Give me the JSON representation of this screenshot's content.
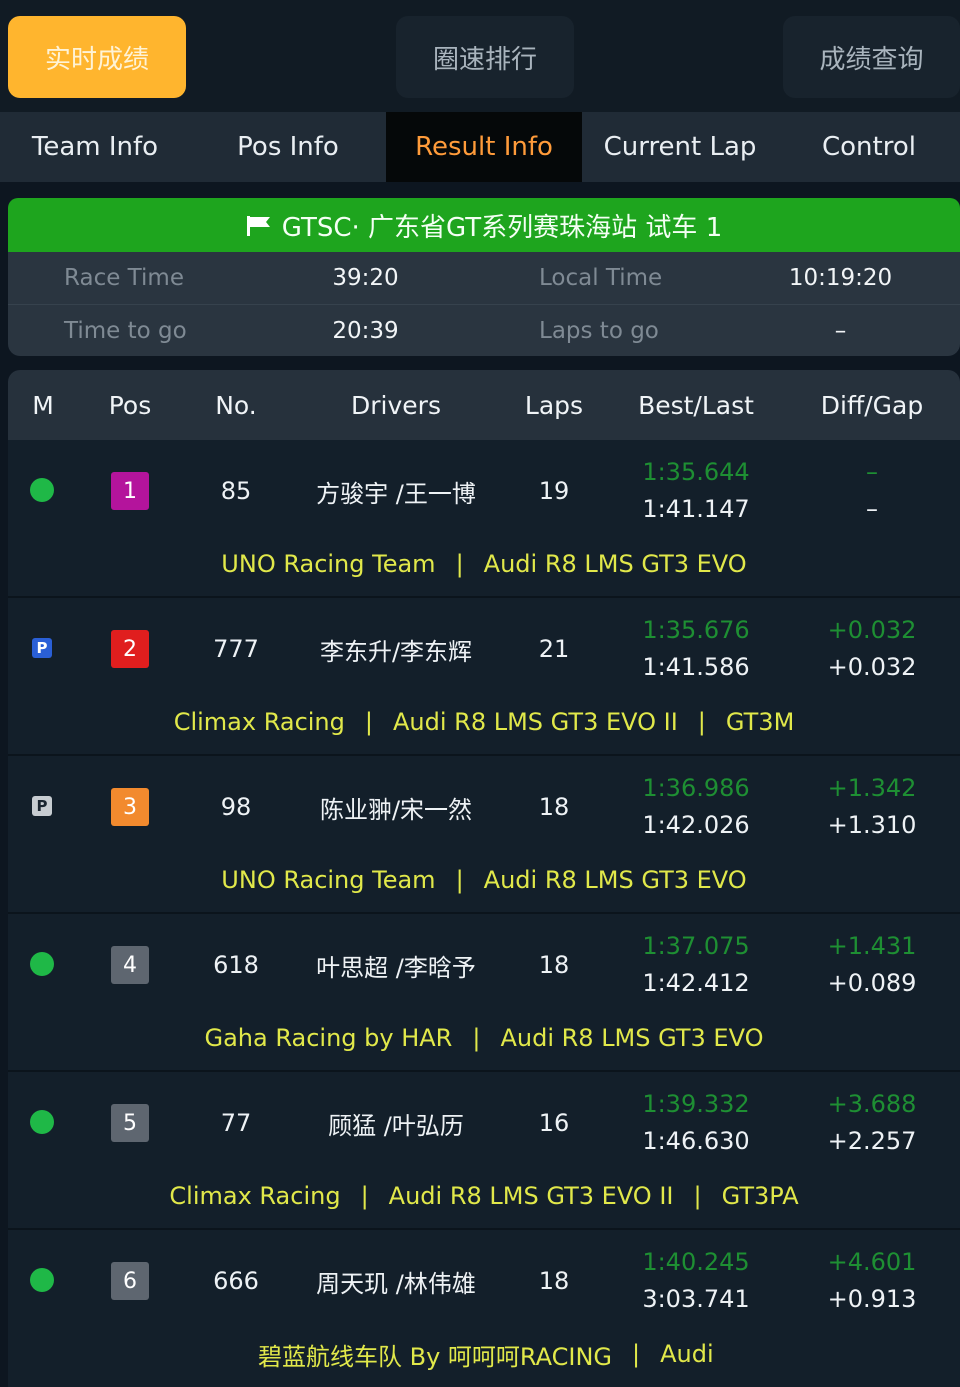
{
  "top_buttons": [
    {
      "label": "实时成绩",
      "active": true
    },
    {
      "label": "圈速排行",
      "active": false
    },
    {
      "label": "成绩查询",
      "active": false
    }
  ],
  "tabs": [
    {
      "label": "Team Info",
      "active": false
    },
    {
      "label": "Pos Info",
      "active": false
    },
    {
      "label": "Result Info",
      "active": true
    },
    {
      "label": "Current Lap",
      "active": false
    },
    {
      "label": "Control",
      "active": false
    }
  ],
  "race": {
    "title": "GTSC· 广东省GT系列赛珠海站 试车 1",
    "status_color": "#1ea51e",
    "race_time_label": "Race Time",
    "race_time": "39:20",
    "local_time_label": "Local Time",
    "local_time": "10:19:20",
    "time_to_go_label": "Time to go",
    "time_to_go": "20:39",
    "laps_to_go_label": "Laps to go",
    "laps_to_go": "–"
  },
  "table": {
    "headers": [
      "M",
      "Pos",
      "No.",
      "Drivers",
      "Laps",
      "Best/Last",
      "Diff/Gap"
    ],
    "rows": [
      {
        "marker": "green-dot",
        "pos": "1",
        "pos_color": "#b4149c",
        "no": "85",
        "drivers": "方骏宇 /王一博",
        "laps": "19",
        "best": "1:35.644",
        "last": "1:41.147",
        "diff": "–",
        "gap": "–",
        "team": "UNO Racing Team",
        "car": "Audi R8 LMS GT3 EVO",
        "class": ""
      },
      {
        "marker": "pit-blue",
        "pos": "2",
        "pos_color": "#e01e1e",
        "no": "777",
        "drivers": "李东升/李东辉",
        "laps": "21",
        "best": "1:35.676",
        "last": "1:41.586",
        "diff": "+0.032",
        "gap": "+0.032",
        "team": "Climax Racing",
        "car": "Audi R8 LMS GT3 EVO II",
        "class": "GT3M"
      },
      {
        "marker": "pit-grey",
        "pos": "3",
        "pos_color": "#f28a2e",
        "no": "98",
        "drivers": "陈业翀/宋一然",
        "laps": "18",
        "best": "1:36.986",
        "last": "1:42.026",
        "diff": "+1.342",
        "gap": "+1.310",
        "team": "UNO Racing Team",
        "car": "Audi R8 LMS GT3 EVO",
        "class": ""
      },
      {
        "marker": "green-dot",
        "pos": "4",
        "pos_color": "#5e6670",
        "no": "618",
        "drivers": "叶思超 /李晗予",
        "laps": "18",
        "best": "1:37.075",
        "last": "1:42.412",
        "diff": "+1.431",
        "gap": "+0.089",
        "team": "Gaha Racing by HAR",
        "car": "Audi R8 LMS GT3 EVO",
        "class": ""
      },
      {
        "marker": "green-dot",
        "pos": "5",
        "pos_color": "#5e6670",
        "no": "77",
        "drivers": "顾猛 /叶弘历",
        "laps": "16",
        "best": "1:39.332",
        "last": "1:46.630",
        "diff": "+3.688",
        "gap": "+2.257",
        "team": "Climax Racing",
        "car": "Audi R8 LMS GT3 EVO II",
        "class": "GT3PA"
      },
      {
        "marker": "green-dot",
        "pos": "6",
        "pos_color": "#5e6670",
        "no": "666",
        "drivers": "周天玑 /林伟雄",
        "laps": "18",
        "best": "1:40.245",
        "last": "3:03.741",
        "diff": "+4.601",
        "gap": "+0.913",
        "team": "碧蓝航线车队 By 呵呵呵RACING",
        "car": "Audi",
        "class": ""
      }
    ]
  }
}
